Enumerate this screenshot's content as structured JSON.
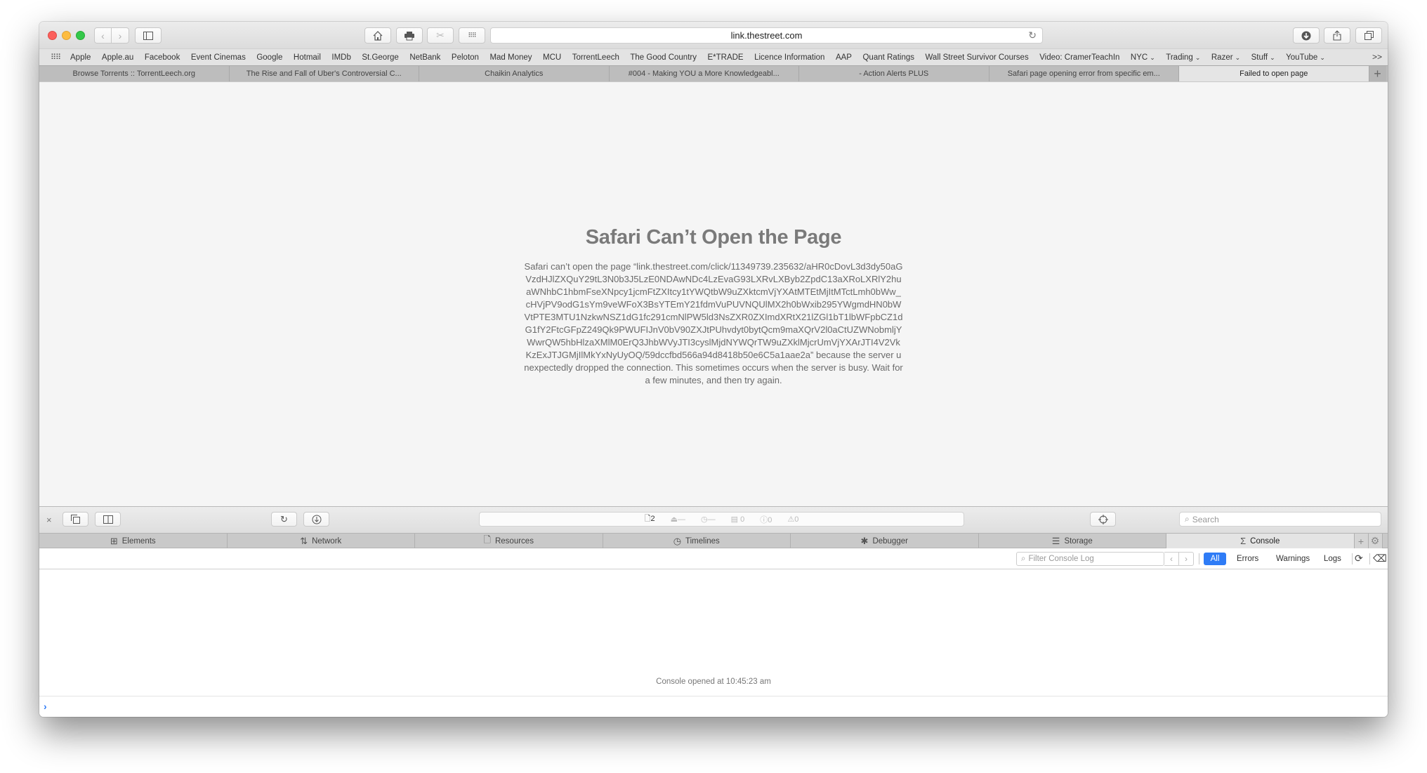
{
  "browser": {
    "address": "link.thestreet.com",
    "bookmarks": [
      {
        "label": "Apple"
      },
      {
        "label": "Apple.au"
      },
      {
        "label": "Facebook"
      },
      {
        "label": "Event Cinemas"
      },
      {
        "label": "Google"
      },
      {
        "label": "Hotmail"
      },
      {
        "label": "IMDb"
      },
      {
        "label": "St.George"
      },
      {
        "label": "NetBank"
      },
      {
        "label": "Peloton"
      },
      {
        "label": "Mad Money"
      },
      {
        "label": "MCU"
      },
      {
        "label": "TorrentLeech"
      },
      {
        "label": "The Good Country"
      },
      {
        "label": "E*TRADE"
      },
      {
        "label": "Licence Information"
      },
      {
        "label": "AAP"
      },
      {
        "label": "Quant Ratings"
      },
      {
        "label": "Wall Street Survivor Courses"
      },
      {
        "label": "Video: CramerTeachIn"
      },
      {
        "label": "NYC",
        "folder": true
      },
      {
        "label": "Trading",
        "folder": true
      },
      {
        "label": "Razer",
        "folder": true
      },
      {
        "label": "Stuff",
        "folder": true
      },
      {
        "label": "YouTube",
        "folder": true
      }
    ],
    "bookmarks_more": ">>",
    "tabs": [
      {
        "label": "Browse Torrents :: TorrentLeech.org",
        "active": false
      },
      {
        "label": "The Rise and Fall of Uber's Controversial C...",
        "active": false
      },
      {
        "label": "Chaikin Analytics",
        "active": false
      },
      {
        "label": "#004 - Making YOU a More Knowledgeabl...",
        "active": false
      },
      {
        "label": "- Action Alerts PLUS",
        "active": false
      },
      {
        "label": "Safari page opening error from specific em...",
        "active": false
      },
      {
        "label": "Failed to open page",
        "active": true
      }
    ],
    "new_tab_symbol": "+"
  },
  "page": {
    "title": "Safari Can’t Open the Page",
    "message": "Safari can’t open the page “link.thestreet.com/click/11349739.235632/aHR0cDovL3d3dy50aGVzdHJlZXQuY29tL3N0b3J5LzE0NDAwNDc4LzEvaG93LXRvLXByb2ZpdC13aXRoLXRlY2huaWNhbC1hbmFseXNpcy1jcmFtZXItcy1tYWQtbW9uZXktcmVjYXAtMTEtMjItMTctLmh0bWw_cHVjPV9odG1sYm9veWFoX3BsYTEmY21fdmVuPUVNQUlMX2h0bWxib295YWgmdHN0bWVtPTE3MTU1NzkwNSZ1dG1fc291cmNlPW5ld3NsZXR0ZXImdXRtX21lZGl1bT1lbWFpbCZ1dG1fY2FtcGFpZ249Qk9PWUFIJnV0bV90ZXJtPUhvdyt0bytQcm9maXQrV2l0aCtUZWNobmljYWwrQW5hbHlzaXMlM0ErQ3JhbWVyJTI3cyslMjdNYWQrTW9uZXklMjcrUmVjYXArJTI4V2VkKzExJTJGMjIlMkYxNyUyOQ/59dccfbd566a94d8418b50e6C5a1aae2a” because the server unexpectedly dropped the connection. This sometimes occurs when the server is busy. Wait for a few minutes, and then try again."
  },
  "devtools": {
    "close_symbol": "×",
    "status": {
      "resources_count": "2",
      "load_size": "—",
      "load_time": "—",
      "logs_count": "0",
      "errors_count": "0",
      "warnings_count": "0"
    },
    "search_placeholder": "Search",
    "tabs": [
      {
        "label": "Elements",
        "icon": "elements-icon",
        "active": false
      },
      {
        "label": "Network",
        "icon": "network-icon",
        "active": false
      },
      {
        "label": "Resources",
        "icon": "resources-icon",
        "active": false
      },
      {
        "label": "Timelines",
        "icon": "timelines-icon",
        "active": false
      },
      {
        "label": "Debugger",
        "icon": "debugger-icon",
        "active": false
      },
      {
        "label": "Storage",
        "icon": "storage-icon",
        "active": false
      },
      {
        "label": "Console",
        "icon": "console-icon",
        "active": true
      }
    ],
    "filter_placeholder": "Filter Console Log",
    "scopes": [
      {
        "label": "All",
        "active": true
      },
      {
        "label": "Errors",
        "active": false
      },
      {
        "label": "Warnings",
        "active": false
      },
      {
        "label": "Logs",
        "active": false
      }
    ],
    "console_message": "Console opened at 10:45:23 am",
    "prompt_symbol": "›",
    "accent_color": "#2f7cf6"
  }
}
